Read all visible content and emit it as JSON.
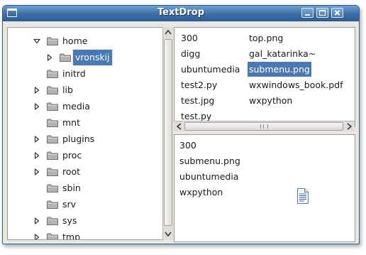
{
  "window": {
    "title": "TextDrop"
  },
  "tree": {
    "items": [
      {
        "label": "home",
        "expander": "expanded",
        "depth": 0,
        "selected": false
      },
      {
        "label": "vronskij",
        "expander": "collapsed",
        "depth": 1,
        "selected": true
      },
      {
        "label": "initrd",
        "expander": "none",
        "depth": 0,
        "selected": false
      },
      {
        "label": "lib",
        "expander": "collapsed",
        "depth": 0,
        "selected": false
      },
      {
        "label": "media",
        "expander": "collapsed",
        "depth": 0,
        "selected": false
      },
      {
        "label": "mnt",
        "expander": "none",
        "depth": 0,
        "selected": false
      },
      {
        "label": "plugins",
        "expander": "collapsed",
        "depth": 0,
        "selected": false
      },
      {
        "label": "proc",
        "expander": "collapsed",
        "depth": 0,
        "selected": false
      },
      {
        "label": "root",
        "expander": "collapsed",
        "depth": 0,
        "selected": false
      },
      {
        "label": "sbin",
        "expander": "none",
        "depth": 0,
        "selected": false
      },
      {
        "label": "srv",
        "expander": "none",
        "depth": 0,
        "selected": false
      },
      {
        "label": "sys",
        "expander": "collapsed",
        "depth": 0,
        "selected": false
      },
      {
        "label": "tmp",
        "expander": "collapsed",
        "depth": 0,
        "selected": false
      }
    ]
  },
  "files": {
    "column1": [
      "300",
      "digg",
      "ubuntumedia",
      "test2.py",
      "test.jpg",
      "test.py"
    ],
    "column2": [
      "top.png",
      "gal_katarinka~",
      "submenu.png",
      "wxwindows_book.pdf",
      "wxpython"
    ],
    "selected": "submenu.png"
  },
  "dropped": {
    "items": [
      "300",
      "submenu.png",
      "ubuntumedia",
      "wxpython"
    ],
    "icon": "text-document-icon"
  },
  "icons": {
    "folder": "folder-icon",
    "expander_collapsed": "triangle-right-icon",
    "expander_expanded": "triangle-down-icon"
  },
  "colors": {
    "titlebar": "#3d70a8",
    "selection": "#4a79b1",
    "folder": "#9a9a96"
  }
}
